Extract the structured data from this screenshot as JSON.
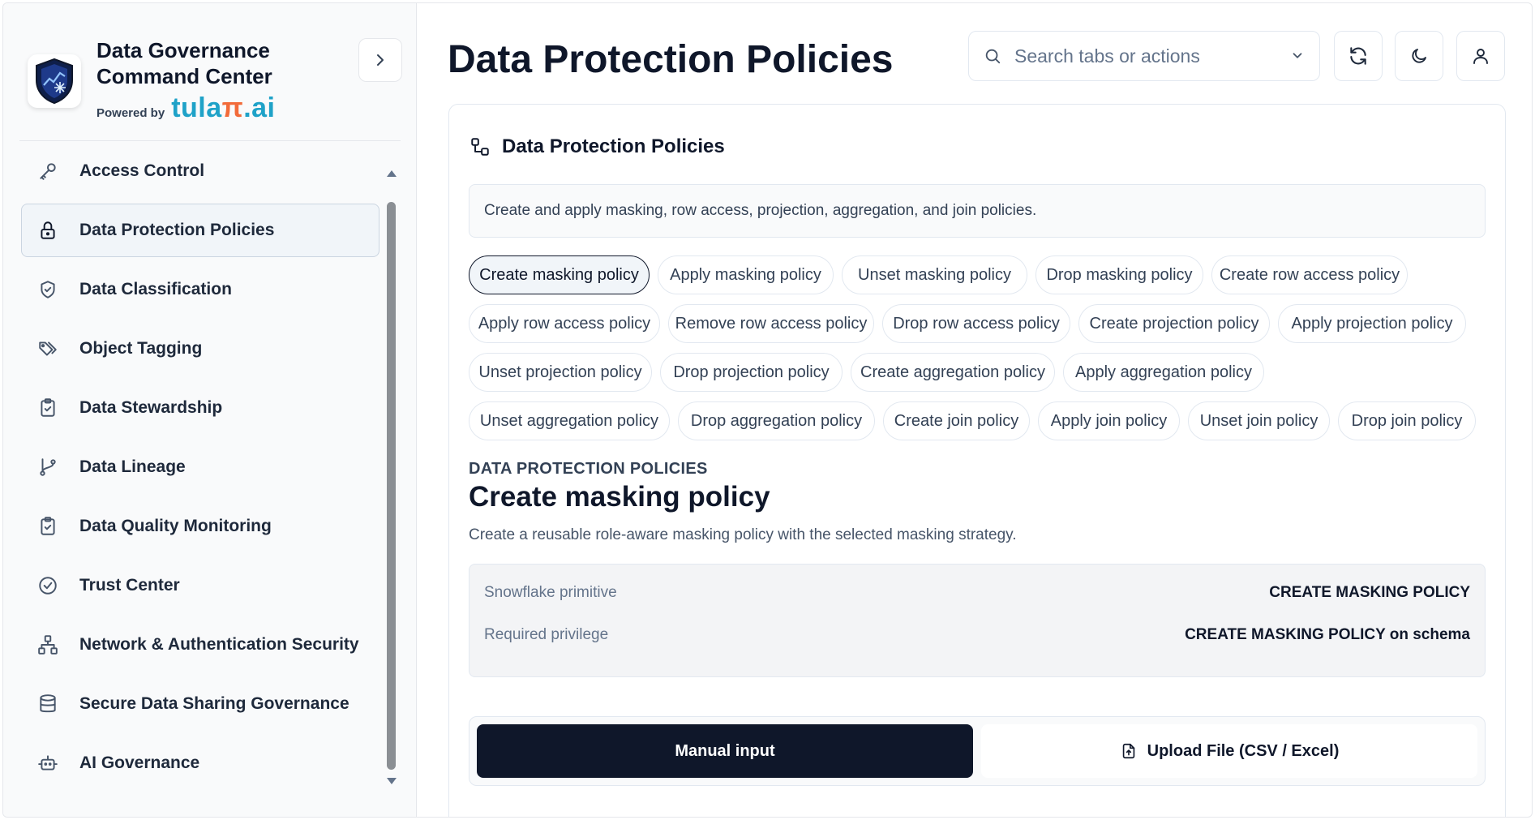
{
  "brand": {
    "title": "Data Governance Command Center",
    "powered_label": "Powered by",
    "powered_brand_a": "tula",
    "powered_brand_b": "π",
    "powered_brand_c": ".ai"
  },
  "sidebar": {
    "items": [
      {
        "label": "Access Control",
        "icon": "key-icon"
      },
      {
        "label": "Data Protection Policies",
        "icon": "lock-icon",
        "active": true
      },
      {
        "label": "Data Classification",
        "icon": "shield-icon"
      },
      {
        "label": "Object Tagging",
        "icon": "tags-icon"
      },
      {
        "label": "Data Stewardship",
        "icon": "clipboard-check-icon"
      },
      {
        "label": "Data Lineage",
        "icon": "git-branch-icon"
      },
      {
        "label": "Data Quality Monitoring",
        "icon": "clipboard-check-icon"
      },
      {
        "label": "Trust Center",
        "icon": "circle-check-icon"
      },
      {
        "label": "Network & Authentication Security",
        "icon": "network-icon"
      },
      {
        "label": "Secure Data Sharing Governance",
        "icon": "database-icon"
      },
      {
        "label": "AI Governance",
        "icon": "bot-icon"
      }
    ]
  },
  "header": {
    "title": "Data Protection Policies",
    "search_placeholder": "Search tabs or actions"
  },
  "card": {
    "title": "Data Protection Policies",
    "description": "Create and apply masking, row access, projection, aggregation, and join policies.",
    "actions": [
      "Create masking policy",
      "Apply masking policy",
      "Unset masking policy",
      "Drop masking policy",
      "Create row access policy",
      "Apply row access policy",
      "Remove row access policy",
      "Drop row access policy",
      "Create projection policy",
      "Apply projection policy",
      "Unset projection policy",
      "Drop projection policy",
      "Create aggregation policy",
      "Apply aggregation policy",
      "Unset aggregation policy",
      "Drop aggregation policy",
      "Create join policy",
      "Apply join policy",
      "Unset join policy",
      "Drop join policy"
    ],
    "selected_action": "Create masking policy"
  },
  "detail": {
    "section_label": "DATA PROTECTION POLICIES",
    "title": "Create masking policy",
    "subtitle": "Create a reusable role-aware masking policy with the selected masking strategy.",
    "rows": [
      {
        "key": "Snowflake primitive",
        "value": "CREATE MASKING POLICY"
      },
      {
        "key": "Required privilege",
        "value": "CREATE MASKING POLICY on schema"
      }
    ]
  },
  "mode": {
    "manual_label": "Manual input",
    "upload_label": "Upload File (CSV / Excel)"
  }
}
